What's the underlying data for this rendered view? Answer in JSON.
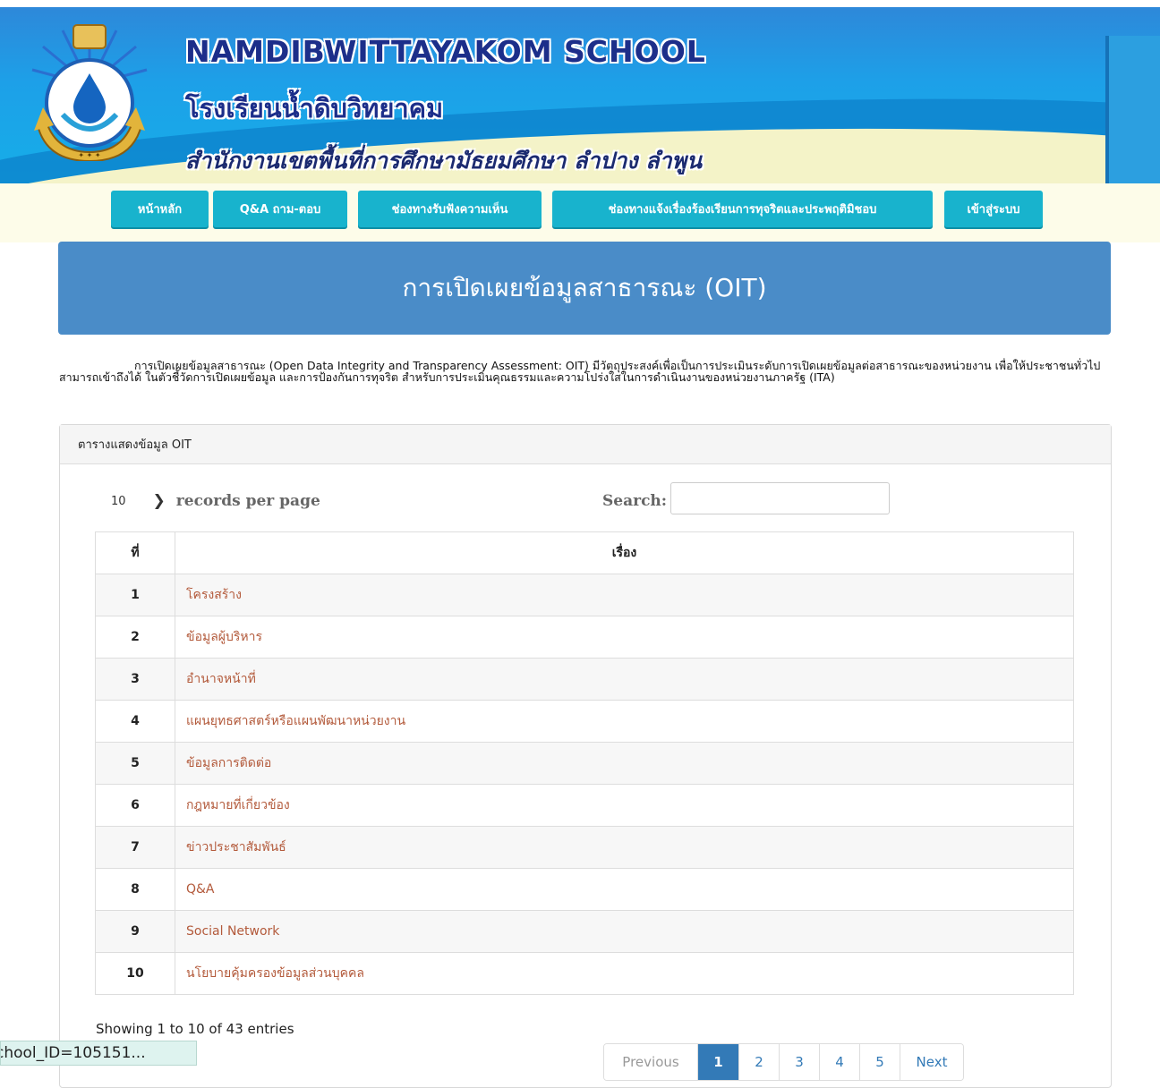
{
  "header": {
    "title_en": "NAMDIBWITTAYAKOM  SCHOOL",
    "title_th": "โรงเรียนน้ำดิบวิทยาคม",
    "subtitle_th": "สำนักงานเขตพื้นที่การศึกษามัธยมศึกษา ลำปาง ลำพูน",
    "logo_text": "โรงเรียนน้ำดิบวิทยาคม"
  },
  "nav": {
    "items": [
      {
        "label": "หน้าหลัก"
      },
      {
        "label": "Q&A ถาม-ตอบ"
      },
      {
        "label": "ช่องทางรับฟังความเห็น"
      },
      {
        "label": "ช่องทางแจ้งเรื่องร้องเรียนการทุจริตและประพฤติมิชอบ"
      },
      {
        "label": "เข้าสู่ระบบ"
      }
    ]
  },
  "hero": {
    "title": "การเปิดเผยข้อมูลสาธารณะ (OIT)"
  },
  "intro": "การเปิดเผยข้อมูลสาธารณะ (Open Data Integrity and Transparency Assessment: OIT) มีวัตถุประสงค์เพื่อเป็นการประเมินระดับการเปิดเผยข้อมูลต่อสาธารณะของหน่วยงาน เพื่อให้ประชาชนทั่วไปสามารถเข้าถึงได้ ในตัวชี้วัดการเปิดเผยข้อมูล และการป้องกันการทุจริต สำหรับการประเมินคุณธรรมและความโปร่งใสในการดำเนินงานของหน่วยงานภาครัฐ (ITA)",
  "panel": {
    "title": "ตารางแสดงข้อมูล OIT",
    "records_per_page_value": "10",
    "records_per_page_label": "records per page",
    "search_label": "Search:",
    "search_value": ""
  },
  "table": {
    "headers": [
      "ที่",
      "เรื่อง"
    ],
    "rows": [
      {
        "no": "1",
        "topic": "โครงสร้าง"
      },
      {
        "no": "2",
        "topic": "ข้อมูลผู้บริหาร"
      },
      {
        "no": "3",
        "topic": "อำนาจหน้าที่"
      },
      {
        "no": "4",
        "topic": "แผนยุทธศาสตร์หรือแผนพัฒนาหน่วยงาน"
      },
      {
        "no": "5",
        "topic": "ข้อมูลการติดต่อ"
      },
      {
        "no": "6",
        "topic": "กฎหมายที่เกี่ยวข้อง"
      },
      {
        "no": "7",
        "topic": "ข่าวประชาสัมพันธ์"
      },
      {
        "no": "8",
        "topic": "Q&A"
      },
      {
        "no": "9",
        "topic": "Social Network"
      },
      {
        "no": "10",
        "topic": "นโยบายคุ้มครองข้อมูลส่วนบุคคล"
      }
    ]
  },
  "info": "Showing 1 to 10 of 43 entries",
  "pagination": {
    "previous": "Previous",
    "pages": [
      "1",
      "2",
      "3",
      "4",
      "5"
    ],
    "next": "Next",
    "active": "1"
  },
  "status_bar": {
    "url": "chool_ID=105151..."
  },
  "colors": {
    "nav_button": "#18b3cd",
    "hero": "#4a8cc8",
    "link": "#b35a3b",
    "page_active": "#337ab7"
  }
}
